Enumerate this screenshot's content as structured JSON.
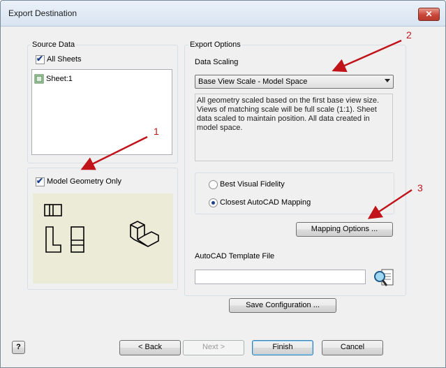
{
  "window": {
    "title": "Export Destination",
    "close_glyph": "✕"
  },
  "source_data": {
    "group_label": "Source Data",
    "all_sheets_label": "All Sheets",
    "all_sheets_checked": true,
    "sheets": [
      {
        "label": "Sheet:1",
        "icon": "sheet-icon"
      }
    ]
  },
  "model_geometry": {
    "label": "Model Geometry Only",
    "checked": true
  },
  "export_options": {
    "group_label": "Export Options",
    "data_scaling_label": "Data Scaling",
    "data_scaling_value": "Base View Scale - Model Space",
    "description": "All geometry scaled based on the first base view size. Views of matching scale will be full scale (1:1). Sheet data scaled to maintain position. All data created in model space.",
    "radio_options": [
      {
        "label": "Best Visual Fidelity",
        "selected": false
      },
      {
        "label": "Closest AutoCAD Mapping",
        "selected": true
      }
    ],
    "mapping_button": "Mapping Options ...",
    "template_label": "AutoCAD Template File",
    "template_value": "",
    "browse_icon": "browse-search-icon"
  },
  "save_config_button": "Save Configuration ...",
  "footer": {
    "help_icon": "help-icon",
    "help_glyph": "?",
    "back": "< Back",
    "next": "Next >",
    "finish": "Finish",
    "cancel": "Cancel"
  },
  "annotations": [
    "1",
    "2",
    "3"
  ],
  "colors": {
    "annotation_red": "#c0141a",
    "preview_bg": "#ecebd8"
  }
}
